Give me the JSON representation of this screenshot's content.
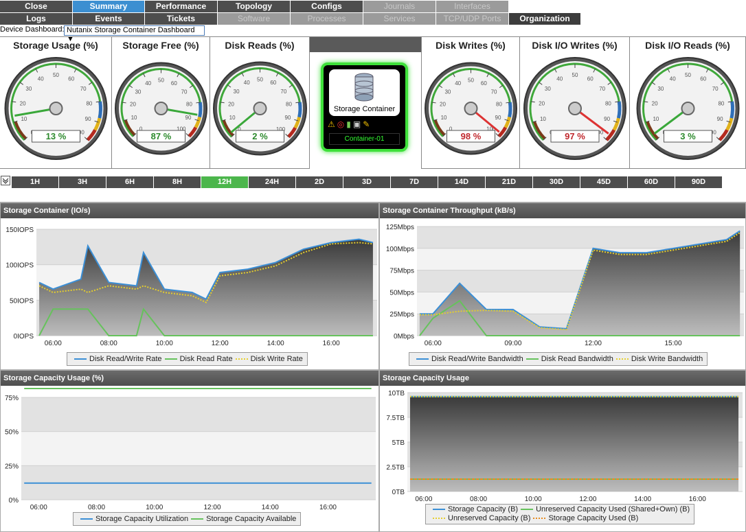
{
  "tabs_row1": [
    {
      "label": "Close",
      "state": "normal"
    },
    {
      "label": "Summary",
      "state": "active"
    },
    {
      "label": "Performance",
      "state": "normal"
    },
    {
      "label": "Topology",
      "state": "normal"
    },
    {
      "label": "Configs",
      "state": "normal"
    },
    {
      "label": "Journals",
      "state": "disabled"
    },
    {
      "label": "Interfaces",
      "state": "disabled"
    }
  ],
  "tabs_row2": [
    {
      "label": "Logs",
      "state": "normal"
    },
    {
      "label": "Events",
      "state": "normal"
    },
    {
      "label": "Tickets",
      "state": "normal"
    },
    {
      "label": "Software",
      "state": "disabled"
    },
    {
      "label": "Processes",
      "state": "disabled"
    },
    {
      "label": "Services",
      "state": "disabled"
    },
    {
      "label": "TCP/UDP Ports",
      "state": "disabled"
    },
    {
      "label": "Organization",
      "state": "normal"
    }
  ],
  "device_dashboard": {
    "label": "Device Dashboard:",
    "selected": "Nutanix Storage Container Dashboard"
  },
  "gauges": [
    {
      "title": "Storage Usage (%)",
      "value": 13,
      "readout": "13",
      "unit": "%",
      "color": "green"
    },
    {
      "title": "Storage Free (%)",
      "value": 87,
      "readout": "87",
      "unit": "%",
      "color": "green"
    },
    {
      "title": "Disk Reads (%)",
      "value": 2,
      "readout": "2",
      "unit": "%",
      "color": "green"
    },
    {
      "title": "Disk Writes (%)",
      "value": 98,
      "readout": "98",
      "unit": "%",
      "color": "red"
    },
    {
      "title": "Disk I/O Writes (%)",
      "value": 97,
      "readout": "97",
      "unit": "%",
      "color": "red"
    },
    {
      "title": "Disk I/O Reads (%)",
      "value": 3,
      "readout": "3",
      "unit": "%",
      "color": "green"
    }
  ],
  "gauge_scale": [
    "0",
    "10",
    "20",
    "30",
    "40",
    "50",
    "60",
    "70",
    "80",
    "90",
    "100"
  ],
  "device_tile": {
    "type": "Storage Container",
    "name": "Container-01"
  },
  "time_buttons": [
    "1H",
    "3H",
    "6H",
    "8H",
    "12H",
    "24H",
    "2D",
    "3D",
    "7D",
    "14D",
    "21D",
    "30D",
    "45D",
    "60D",
    "90D"
  ],
  "time_active": "12H",
  "colors": {
    "read_write": "#3b8fd6",
    "read": "#66c25c",
    "write": "#e6cf2d",
    "orange": "#e88a1e"
  },
  "panels": {
    "io": {
      "title": "Storage Container (IO/s)",
      "yticks": [
        "150IOPS",
        "100IOPS",
        "50IOPS",
        "0IOPS"
      ],
      "xticks": [
        "06:00",
        "08:00",
        "10:00",
        "12:00",
        "14:00",
        "16:00"
      ],
      "legend": [
        "Disk Read/Write Rate",
        "Disk Read Rate",
        "Disk Write Rate"
      ]
    },
    "throughput": {
      "title": "Storage Container Throughput (kB/s)",
      "yticks": [
        "125Mbps",
        "100Mbps",
        "75Mbps",
        "50Mbps",
        "25Mbps",
        "0Mbps"
      ],
      "xticks": [
        "06:00",
        "09:00",
        "12:00",
        "15:00"
      ],
      "legend": [
        "Disk Read/Write Bandwidth",
        "Disk Read Bandwidth",
        "Disk Write Bandwidth"
      ]
    },
    "cap_pct": {
      "title": "Storage Capacity Usage (%)",
      "yticks": [
        "75%",
        "50%",
        "25%",
        "0%"
      ],
      "xticks": [
        "06:00",
        "08:00",
        "10:00",
        "12:00",
        "14:00",
        "16:00"
      ],
      "legend": [
        "Storage Capacity Utilization",
        "Storage Capacity Available"
      ]
    },
    "cap": {
      "title": "Storage Capacity Usage",
      "yticks": [
        "10TB",
        "7.5TB",
        "5TB",
        "2.5TB",
        "0TB"
      ],
      "xticks": [
        "06:00",
        "08:00",
        "10:00",
        "12:00",
        "14:00",
        "16:00"
      ],
      "legend": [
        "Storage Capacity (B)",
        "Unreserved Capacity Used (Shared+Own) (B)",
        "Unreserved Capacity (B)",
        "Storage Capacity Used (B)"
      ]
    }
  },
  "chart_data": [
    {
      "type": "area",
      "title": "Storage Container (IO/s)",
      "x": [
        "05:30",
        "06:00",
        "07:00",
        "07:15",
        "08:00",
        "09:00",
        "09:15",
        "10:00",
        "11:00",
        "11:30",
        "12:00",
        "13:00",
        "14:00",
        "15:00",
        "16:00",
        "17:00",
        "17:30"
      ],
      "series": [
        {
          "name": "Disk Read/Write Rate",
          "values": [
            80,
            70,
            85,
            135,
            80,
            75,
            125,
            70,
            65,
            55,
            95,
            100,
            110,
            130,
            140,
            145,
            140
          ]
        },
        {
          "name": "Disk Read Rate",
          "values": [
            0,
            40,
            40,
            40,
            0,
            0,
            40,
            0,
            0,
            0,
            0,
            0,
            0,
            0,
            0,
            0,
            0
          ]
        },
        {
          "name": "Disk Write Rate",
          "values": [
            75,
            65,
            70,
            65,
            75,
            70,
            75,
            65,
            60,
            50,
            90,
            95,
            105,
            125,
            138,
            140,
            138
          ]
        }
      ],
      "ylim": [
        0,
        160
      ]
    },
    {
      "type": "area",
      "title": "Storage Container Throughput (kB/s)",
      "x": [
        "05:30",
        "06:00",
        "07:00",
        "08:00",
        "09:00",
        "10:00",
        "11:00",
        "12:00",
        "13:00",
        "14:00",
        "15:00",
        "16:00",
        "17:00",
        "17:30"
      ],
      "series": [
        {
          "name": "Disk Read/Write Bandwidth",
          "values": [
            25,
            25,
            60,
            30,
            30,
            10,
            8,
            100,
            95,
            95,
            100,
            105,
            110,
            120
          ]
        },
        {
          "name": "Disk Read Bandwidth",
          "values": [
            0,
            20,
            40,
            0,
            0,
            0,
            0,
            0,
            0,
            0,
            0,
            0,
            0,
            0
          ]
        },
        {
          "name": "Disk Write Bandwidth",
          "values": [
            24,
            24,
            28,
            29,
            28,
            9,
            7,
            98,
            93,
            93,
            98,
            103,
            108,
            118
          ]
        }
      ],
      "ylim": [
        0,
        130
      ]
    },
    {
      "type": "line",
      "title": "Storage Capacity Usage (%)",
      "x": [
        "05:30",
        "17:30"
      ],
      "series": [
        {
          "name": "Storage Capacity Utilization",
          "values": [
            13,
            13
          ]
        },
        {
          "name": "Storage Capacity Available",
          "values": [
            87,
            87
          ]
        }
      ],
      "ylim": [
        0,
        100
      ]
    },
    {
      "type": "area",
      "title": "Storage Capacity Usage",
      "x": [
        "05:30",
        "17:30"
      ],
      "series": [
        {
          "name": "Storage Capacity (B)",
          "values": [
            9.6,
            9.6
          ]
        },
        {
          "name": "Unreserved Capacity Used (Shared+Own) (B)",
          "values": [
            1.25,
            1.25
          ]
        },
        {
          "name": "Unreserved Capacity (B)",
          "values": [
            9.6,
            9.6
          ]
        },
        {
          "name": "Storage Capacity Used (B)",
          "values": [
            1.25,
            1.25
          ]
        }
      ],
      "ylim": [
        0,
        10
      ]
    }
  ]
}
